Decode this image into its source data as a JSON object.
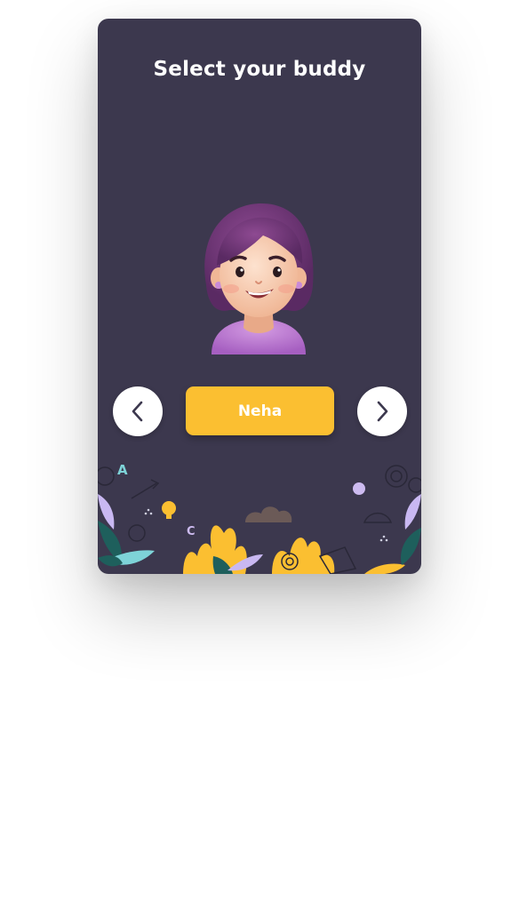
{
  "header": {
    "title": "Select your buddy"
  },
  "buddy": {
    "name": "Neha"
  },
  "nav": {
    "prev_icon": "chevron-left-icon",
    "next_icon": "chevron-right-icon"
  },
  "decor": {
    "glyph_a": "A",
    "glyph_c": "C"
  },
  "colors": {
    "card": "#3c384e",
    "accent": "#fbbf31",
    "text": "#ffffff"
  }
}
